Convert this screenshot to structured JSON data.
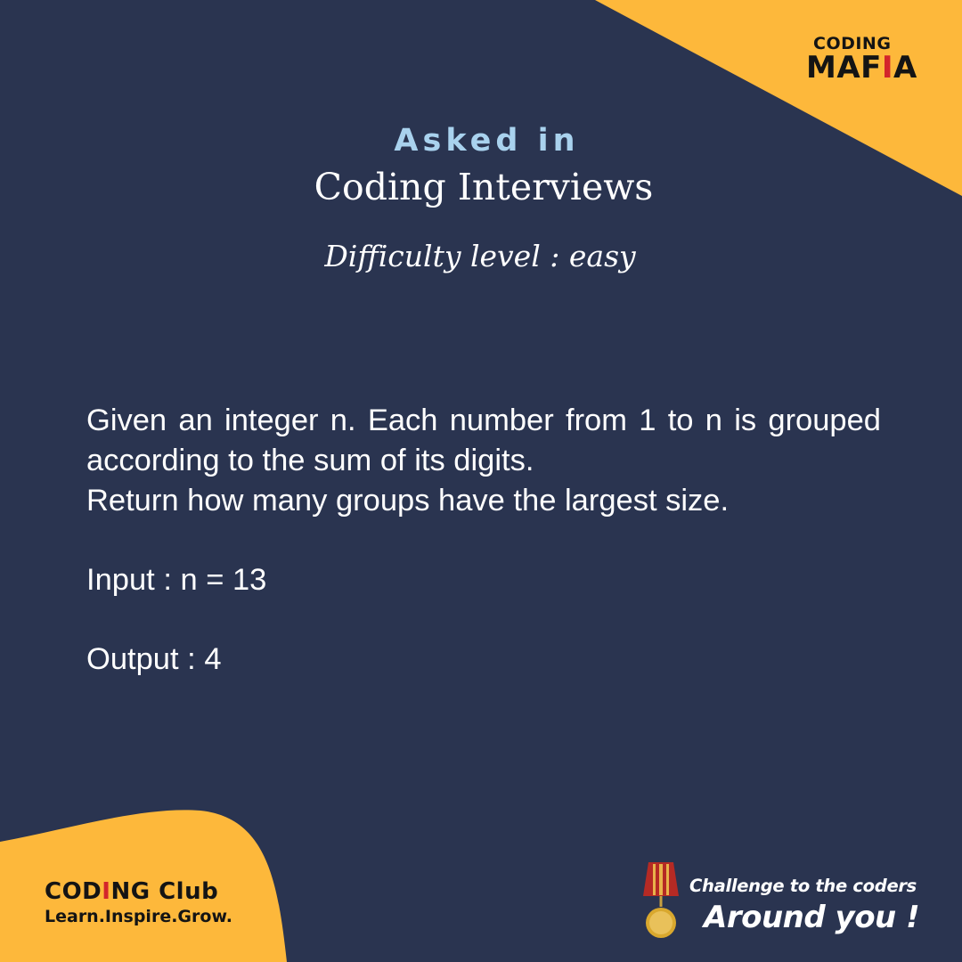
{
  "colors": {
    "background": "#2a3450",
    "accent": "#fdb83b",
    "heading_accent": "#a9d2ee",
    "text": "#ffffff",
    "logo_red": "#d3252b"
  },
  "brand_top": {
    "line1": "CODING",
    "line2_prefix": "MAF",
    "line2_letter": "I",
    "line2_suffix": "A"
  },
  "header": {
    "asked_in": "Asked in",
    "interviews": "Coding Interviews",
    "difficulty": "Difficulty level : easy"
  },
  "problem": {
    "line1": "Given an integer n. Each number from 1 to n is grouped according to the sum of its digits.",
    "line2": "Return how many groups have the largest size.",
    "input": "Input : n = 13",
    "output": "Output : 4"
  },
  "club": {
    "name_prefix": "COD",
    "name_letter": "I",
    "name_suffix": "NG Club",
    "tagline": "Learn.Inspire.Grow."
  },
  "footer": {
    "challenge": "Challenge to the coders",
    "around": "Around you !",
    "medal_icon": "medal-icon"
  }
}
